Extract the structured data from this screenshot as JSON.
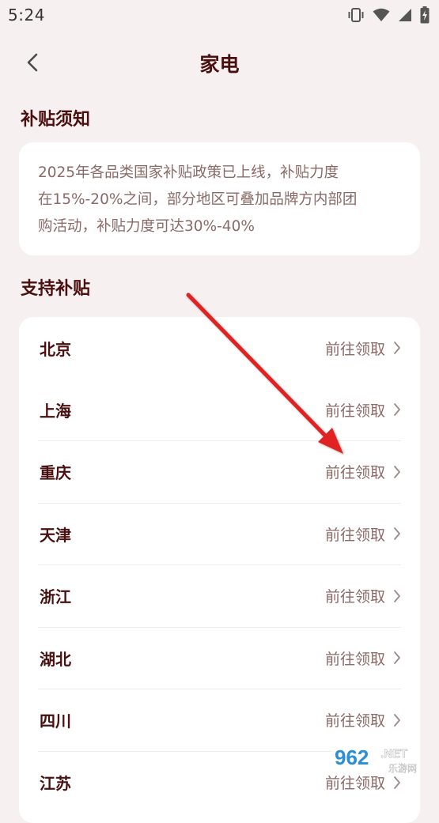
{
  "status_bar": {
    "time": "5:24",
    "icons": [
      "vibrate-icon",
      "wifi-icon",
      "signal-icon",
      "battery-charging-icon"
    ]
  },
  "header": {
    "title": "家电",
    "back_icon": "chevron-left-icon"
  },
  "notice": {
    "title": "补贴须知",
    "lines": [
      "2025年各品类国家补贴政策已上线，补贴力度",
      "在15%-20%之间，部分地区可叠加品牌方内部团",
      "购活动，补贴力度可达30%-40%"
    ]
  },
  "support": {
    "title": "支持补贴",
    "items": [
      {
        "label": "北京",
        "action": "前往领取"
      },
      {
        "label": "上海",
        "action": "前往领取"
      },
      {
        "label": "重庆",
        "action": "前往领取"
      },
      {
        "label": "天津",
        "action": "前往领取"
      },
      {
        "label": "浙江",
        "action": "前往领取"
      },
      {
        "label": "湖北",
        "action": "前往领取"
      },
      {
        "label": "四川",
        "action": "前往领取"
      },
      {
        "label": "江苏",
        "action": "前往领取"
      }
    ]
  },
  "colors": {
    "background": "#f6f1f0",
    "card": "#ffffff",
    "title_text": "#4a0f0f",
    "muted_text": "#8a6a66",
    "annotation_arrow": "#e02020"
  },
  "watermark": {
    "brand": "962",
    "suffix": ".NET",
    "sub": "乐游网"
  }
}
